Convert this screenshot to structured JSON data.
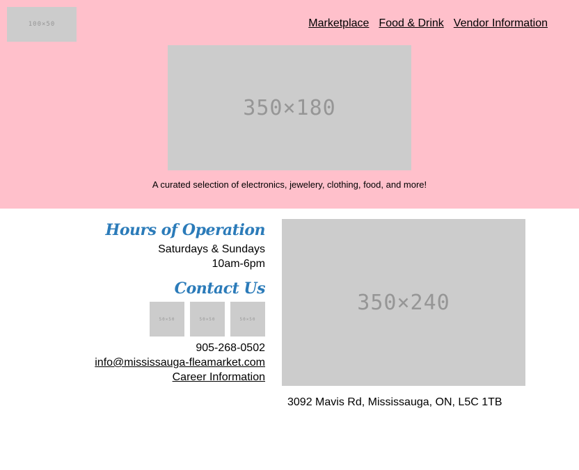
{
  "header": {
    "logo_text": "100×50",
    "hero_text": "350×180",
    "tagline": "A curated selection of electronics, jewelery, clothing, food, and more!"
  },
  "nav": {
    "items": [
      {
        "label": "Marketplace"
      },
      {
        "label": "Food & Drink"
      },
      {
        "label": "Vendor Information"
      }
    ]
  },
  "hours": {
    "heading": "Hours of Operation",
    "days": "Saturdays & Sundays",
    "time": "10am-6pm"
  },
  "contact": {
    "heading": "Contact Us",
    "social_icons": [
      {
        "text": "50×50",
        "icon": "social-icon"
      },
      {
        "text": "50×50",
        "icon": "social-icon"
      },
      {
        "text": "50×50",
        "icon": "social-icon"
      }
    ],
    "phone": "905-268-0502",
    "email": "info@mississauga-fleamarket.com",
    "careers": "Career Information"
  },
  "location": {
    "map_text": "350×240",
    "address": "3092 Mavis Rd, Mississauga, ON, L5C 1TB"
  },
  "colors": {
    "header_bg": "#ffc0cb",
    "heading_blue": "#2b7bb9",
    "placeholder_bg": "#cccccc"
  }
}
